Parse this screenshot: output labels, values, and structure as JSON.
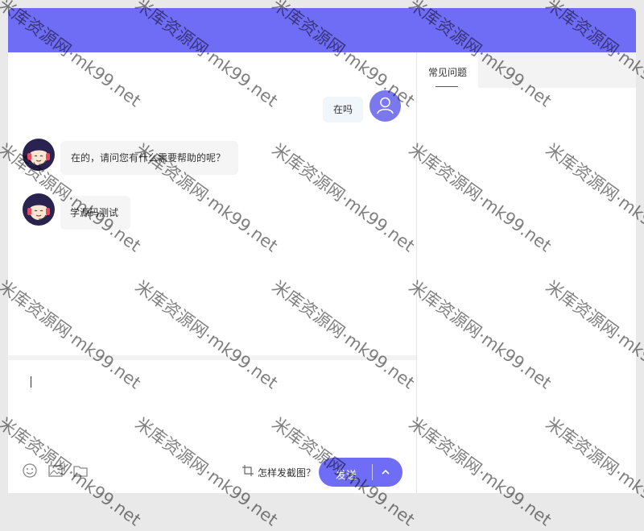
{
  "chat": {
    "messages": [
      {
        "from": "user",
        "text": "在吗"
      },
      {
        "from": "agent",
        "text": "在的，请问您有什么需要帮助的呢？"
      },
      {
        "from": "agent",
        "text": "学源码测试"
      }
    ],
    "input": {
      "value": ""
    }
  },
  "toolbar": {
    "icons": [
      "emoji-icon",
      "image-icon",
      "folder-icon"
    ],
    "screenshot_hint": "怎样发截图？",
    "send_label": "发送"
  },
  "side": {
    "tabs": [
      {
        "label": "常见问题",
        "active": true
      }
    ]
  },
  "watermark": {
    "text": "米库资源网·mk99.net"
  },
  "colors": {
    "accent": "#6f6cf5",
    "page_bg": "#e9e9e9"
  }
}
